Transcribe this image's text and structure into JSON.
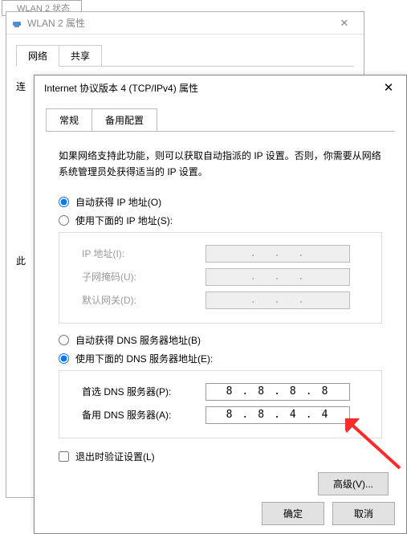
{
  "win0": {
    "title": "WLAN 2 状态"
  },
  "win1": {
    "title": "WLAN 2 属性",
    "tabs": {
      "network": "网络",
      "sharing": "共享"
    },
    "label_conn": "连",
    "label_this": "此",
    "label_checkrow": "☑"
  },
  "win2": {
    "title": "Internet 协议版本 4 (TCP/IPv4) 属性",
    "tabs": {
      "general": "常规",
      "alt": "备用配置"
    },
    "description": "如果网络支持此功能，则可以获取自动指派的 IP 设置。否则，你需要从网络系统管理员处获得适当的 IP 设置。",
    "radio_auto_ip": "自动获得 IP 地址(O)",
    "radio_manual_ip": "使用下面的 IP 地址(S):",
    "field_ip": "IP 地址(I):",
    "field_mask": "子网掩码(U):",
    "field_gateway": "默认网关(D):",
    "radio_auto_dns": "自动获得 DNS 服务器地址(B)",
    "radio_manual_dns": "使用下面的 DNS 服务器地址(E):",
    "field_dns1": "首选 DNS 服务器(P):",
    "field_dns2": "备用 DNS 服务器(A):",
    "dns1_value": [
      "8",
      "8",
      "8",
      "8"
    ],
    "dns2_value": [
      "8",
      "8",
      "4",
      "4"
    ],
    "chk_validate": "退出时验证设置(L)",
    "btn_advanced": "高级(V)...",
    "btn_ok": "确定",
    "btn_cancel": "取消"
  }
}
